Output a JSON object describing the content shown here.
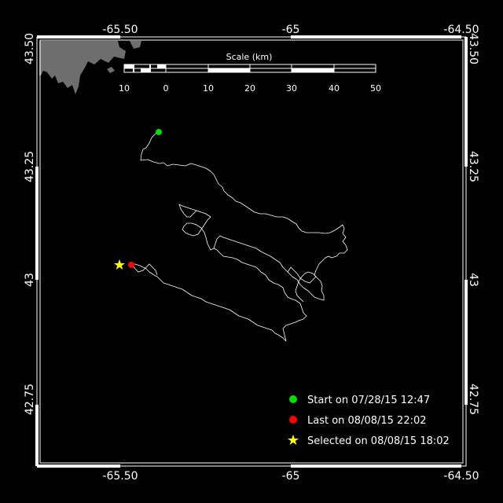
{
  "map": {
    "lon_ticks": [
      "-65.50",
      "-65",
      "-64.50"
    ],
    "lat_ticks": [
      "43.50",
      "43.25",
      "43",
      "42.75"
    ],
    "scale": {
      "title": "Scale (km)",
      "labels": [
        "10",
        "0",
        "10",
        "20",
        "30",
        "40",
        "50"
      ]
    },
    "legend": [
      {
        "text": "Start on 07/28/15 12:47",
        "color": "#00e000",
        "symbol": "circle"
      },
      {
        "text": "Last on 08/08/15 22:02",
        "color": "#ff0000",
        "symbol": "circle"
      },
      {
        "text": "Selected on 08/08/15 18:02",
        "color": "#ffff00",
        "symbol": "star"
      }
    ],
    "colors": {
      "background": "#000000",
      "land": "#6e6e6e",
      "track": "#ffffff",
      "frame": "#ffffff"
    }
  }
}
